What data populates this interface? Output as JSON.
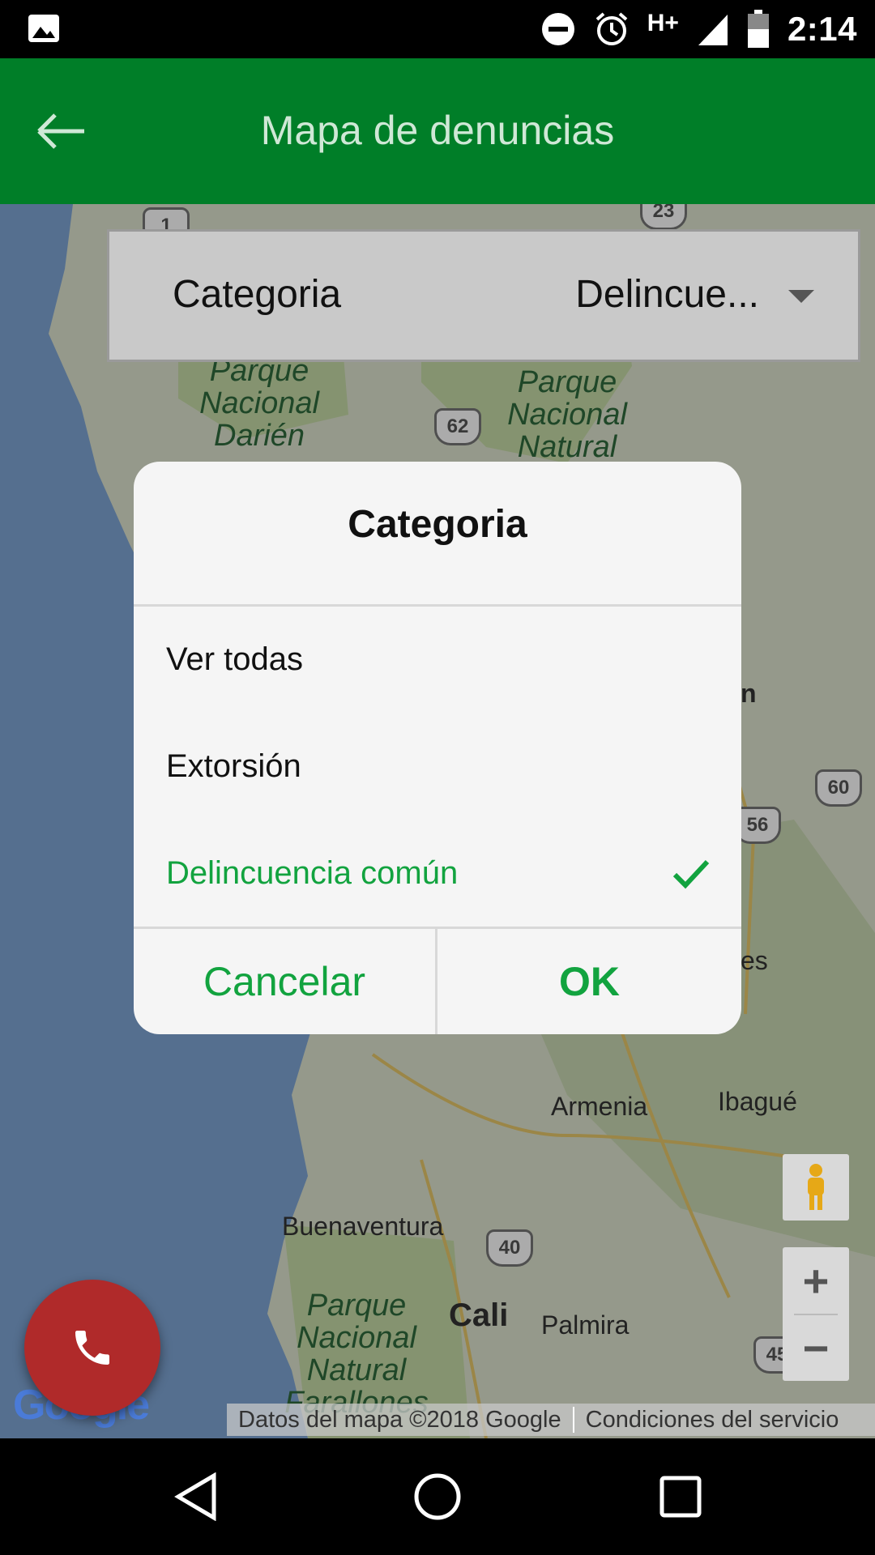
{
  "status_bar": {
    "time": "2:14",
    "network": "H+",
    "icons": [
      "gallery-icon",
      "dnd-icon",
      "alarm-icon",
      "signal-icon",
      "battery-icon"
    ]
  },
  "app_bar": {
    "title": "Mapa de denuncias",
    "back_icon": "arrow-left-icon",
    "color": "#007E28"
  },
  "filter": {
    "label": "Categoria",
    "value": "Delincue..."
  },
  "map": {
    "labels": {
      "darien": "Parque Nacional Darién",
      "natural": "Parque Nacional Natural",
      "farallones": "Parque Nacional Natural Farallones",
      "armenia": "Armenia",
      "ibague": "Ibagué",
      "buenaventura": "Buenaventura",
      "cali": "Cali",
      "palmira": "Palmira",
      "es": "es",
      "n": "n"
    },
    "shields": [
      "1",
      "23",
      "62",
      "60",
      "56",
      "40",
      "45"
    ],
    "google_logo": "Google",
    "attribution": {
      "data": "Datos del mapa ©2018 Google",
      "terms": "Condiciones del servicio"
    }
  },
  "dialog": {
    "title": "Categoria",
    "options": [
      {
        "label": "Ver todas",
        "selected": false
      },
      {
        "label": "Extorsión",
        "selected": false
      },
      {
        "label": "Delincuencia común",
        "selected": true
      }
    ],
    "cancel_label": "Cancelar",
    "ok_label": "OK",
    "accent_color": "#12a33f"
  },
  "controls": {
    "zoom_in": "+",
    "zoom_out": "−"
  }
}
